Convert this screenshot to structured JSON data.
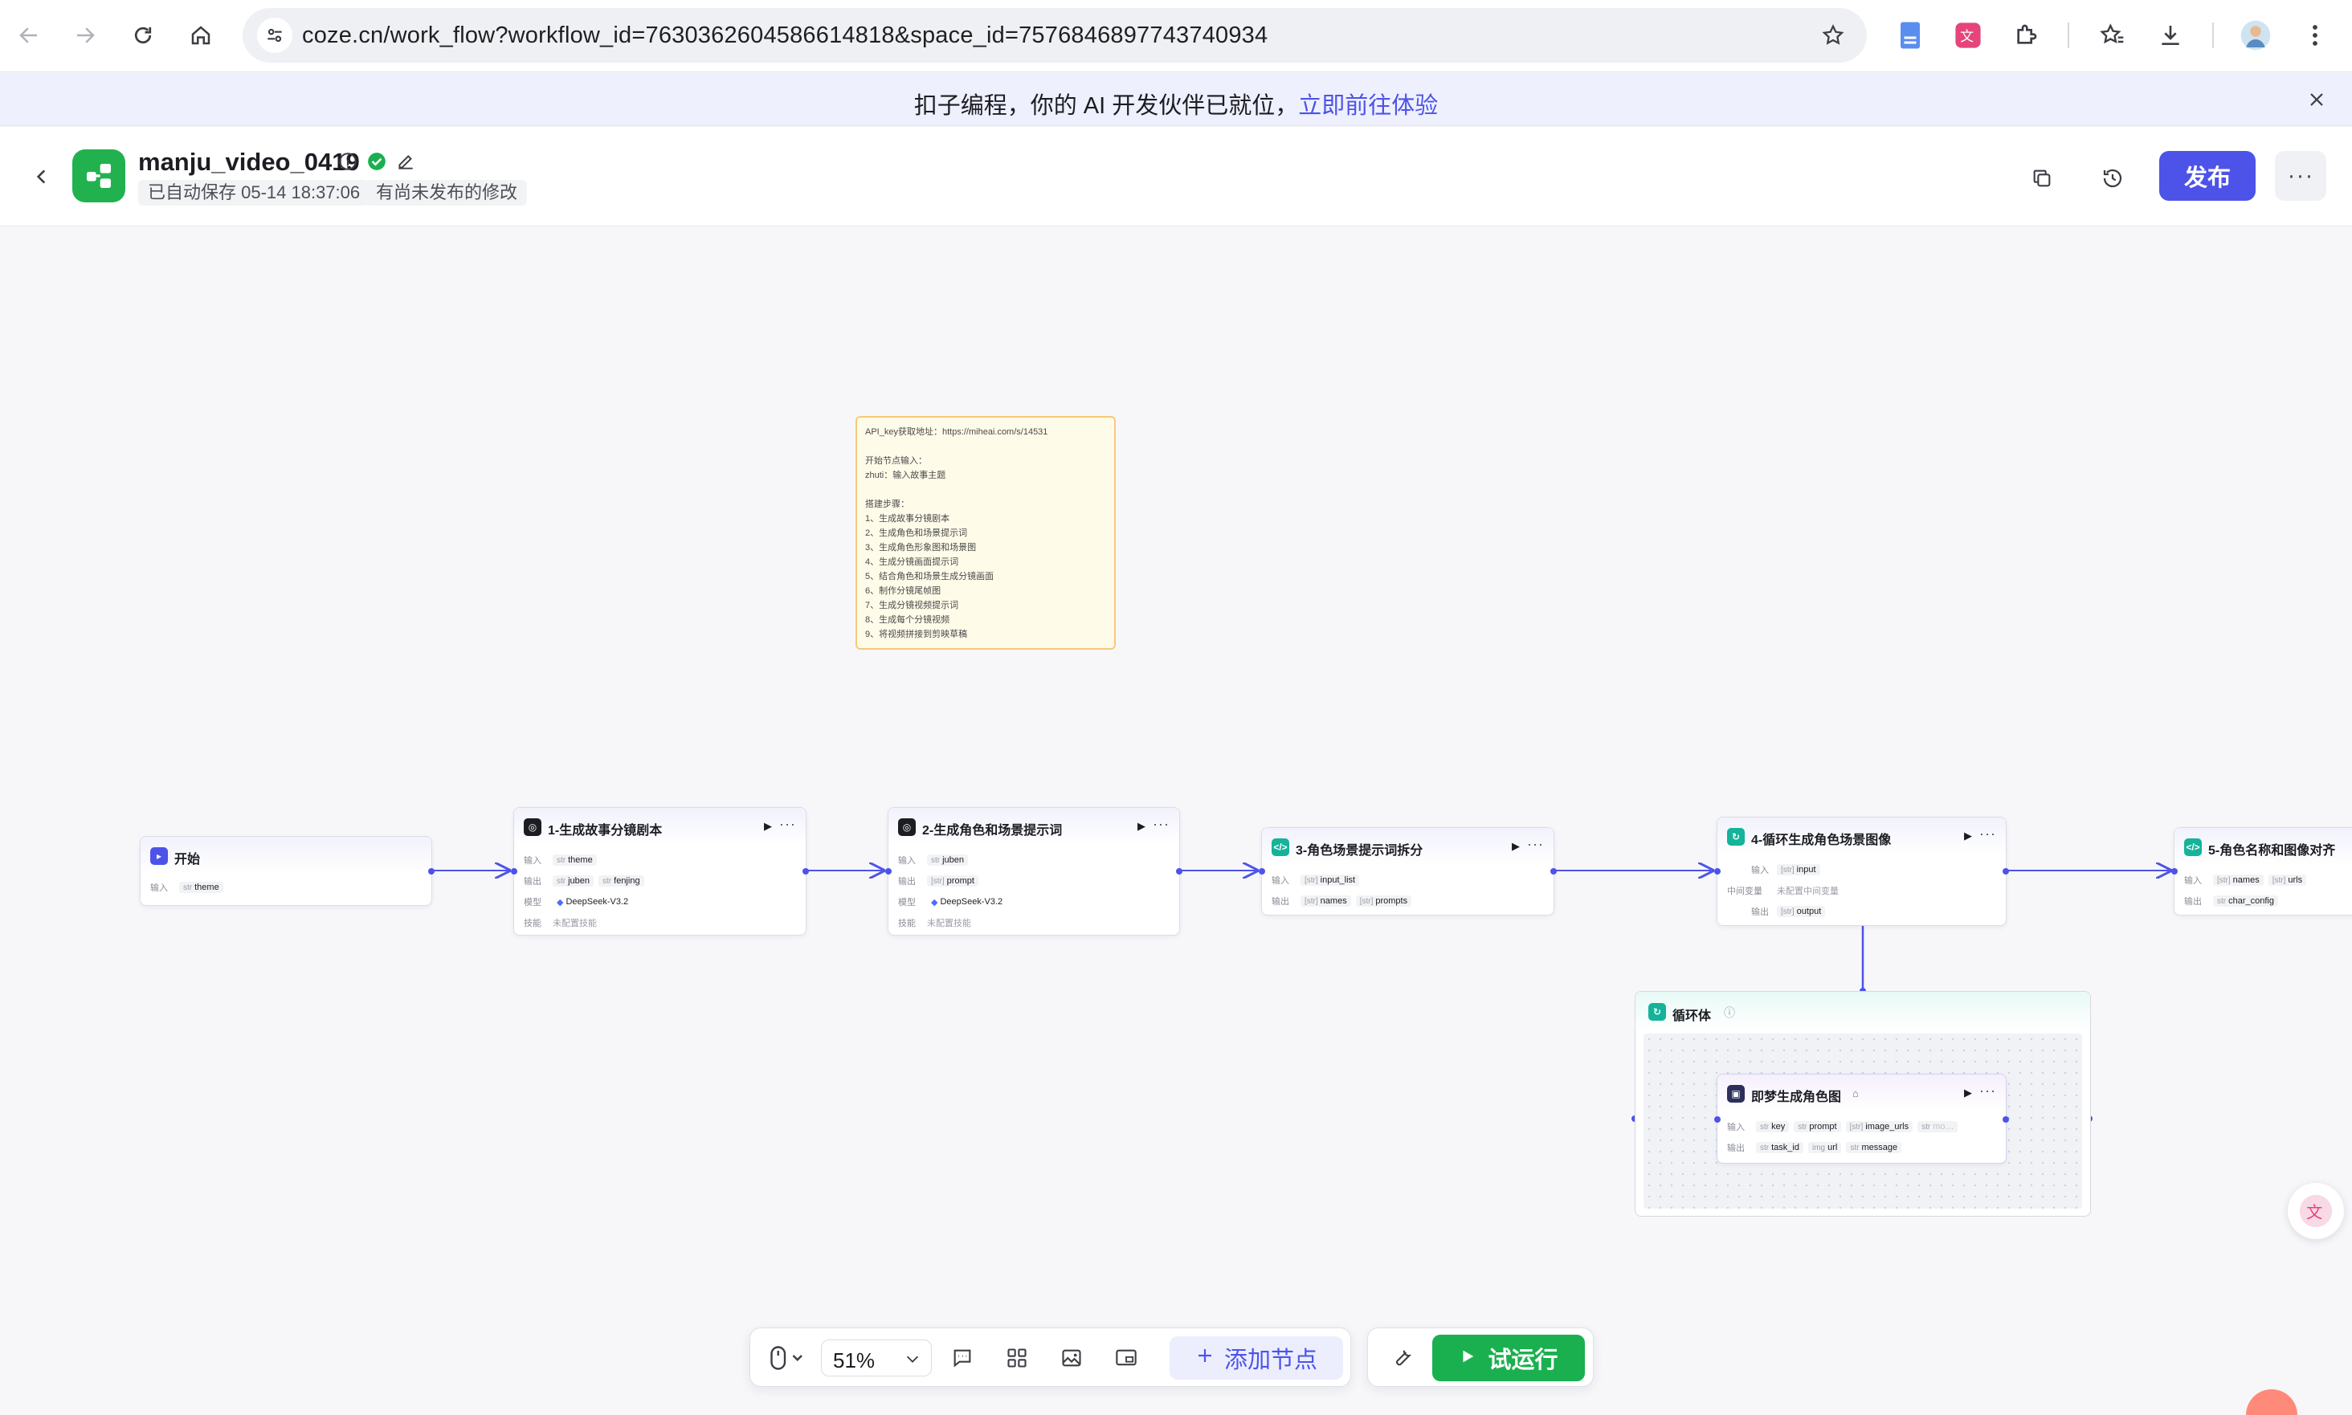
{
  "browser": {
    "url": "coze.cn/work_flow?workflow_id=7630362604586614818&space_id=7576846897743740934"
  },
  "banner": {
    "text": "扣子编程，你的 AI 开发伙伴已就位，",
    "link": "立即前往体验"
  },
  "header": {
    "title": "manju_video_0419",
    "autosave": "已自动保存 05-14 18:37:06",
    "unpublished": "有尚未发布的修改",
    "publish_label": "发布",
    "more_label": "···"
  },
  "note": {
    "text": "API_key获取地址：https://miheai.com/s/14531\n\n开始节点输入：\nzhuti：输入故事主题\n\n搭建步骤：\n1、生成故事分镜剧本\n2、生成角色和场景提示词\n3、生成角色形象图和场景图\n4、生成分镜画面提示词\n5、结合角色和场景生成分镜画面\n6、制作分镜尾帧图\n7、生成分镜视频提示词\n8、生成每个分镜视频\n9、将视频拼接到剪映草稿"
  },
  "labels": {
    "input": "输入",
    "output": "输出",
    "model": "模型",
    "skill": "技能",
    "intermediate": "中间变量",
    "skill_none": "未配置技能",
    "intermediate_none": "未配置中间变量"
  },
  "types": {
    "str": "str",
    "arr_str": "[str]",
    "arr_obj": "[obj]",
    "img": "img"
  },
  "nodes": {
    "start": {
      "title": "开始",
      "input_var": "theme"
    },
    "n1": {
      "title": "1-生成故事分镜剧本",
      "input_var": "theme",
      "output_a": "juben",
      "output_b": "fenjing",
      "model": "DeepSeek-V3.2"
    },
    "n2": {
      "title": "2-生成角色和场景提示词",
      "input_var": "juben",
      "output_a": "prompt",
      "model": "DeepSeek-V3.2"
    },
    "n3": {
      "title": "3-角色场景提示词拆分",
      "input_var": "input_list",
      "output_a": "names",
      "output_b": "prompts"
    },
    "n4": {
      "title": "4-循环生成角色场景图像",
      "input_var": "input",
      "output_a": "output"
    },
    "n5": {
      "title": "5-角色名称和图像对齐",
      "input_a": "names",
      "input_b": "urls",
      "output_a": "char_config"
    },
    "loop": {
      "title": "循环体"
    },
    "jimeng": {
      "title": "即梦生成角色图",
      "in_a": "key",
      "in_b": "prompt",
      "in_c": "image_urls",
      "in_d": "mo…",
      "out_a": "task_id",
      "out_b": "url",
      "out_c": "message"
    }
  },
  "toolbar": {
    "zoom": "51%",
    "add_node": "添加节点",
    "test_run": "试运行"
  },
  "colors": {
    "accent": "#4d53e8",
    "run_green": "#1ab04f",
    "logo_green": "#21b24f",
    "note_bg": "#fffbe9"
  }
}
